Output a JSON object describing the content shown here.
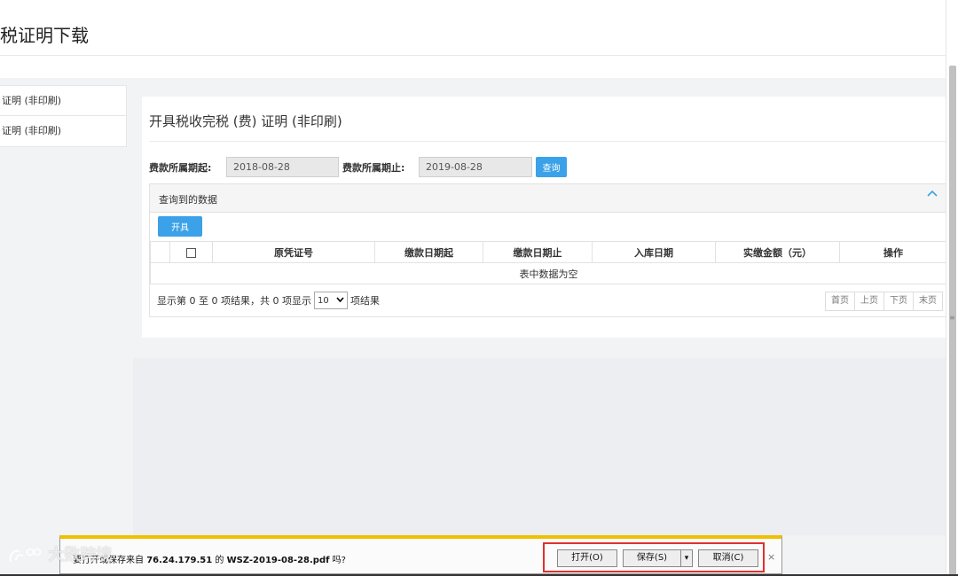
{
  "header": {
    "title": "税证明下载"
  },
  "sidebar": {
    "items": [
      {
        "label": "证明 (非印刷)"
      },
      {
        "label": "证明 (非印刷)"
      }
    ]
  },
  "panel": {
    "title": "开具税收完税 (费) 证明 (非印刷)",
    "filters": {
      "start_label": "费款所属期起:",
      "start_value": "2018-08-28",
      "end_label": "费款所属期止:",
      "end_value": "2019-08-28",
      "query_button": "查询"
    },
    "results": {
      "title": "查询到的数据",
      "issue_button": "开具",
      "columns": [
        "原凭证号",
        "缴款日期起",
        "缴款日期止",
        "入库日期",
        "实缴金额（元）",
        "操作"
      ],
      "empty_text": "表中数据为空",
      "pager_text_before": "显示第 0 至 0 项结果，共 0 项显示",
      "page_size": "10",
      "pager_text_after": "项结果",
      "pager_buttons": {
        "first": "首页",
        "prev": "上页",
        "next": "下页",
        "last": "末页"
      }
    }
  },
  "download_bar": {
    "message_prefix": "要打开或保存来自 ",
    "host": "76.24.179.51",
    "message_mid": " 的 ",
    "filename": "WSZ-2019-08-28.pdf",
    "message_suffix": " 吗?",
    "open_button": "打开(O)",
    "save_button": "保存(S)",
    "save_arrow": "▾",
    "cancel_button": "取消(C)",
    "close": "×"
  },
  "watermark": "大数跨境",
  "icons": {
    "collapse": "chevron-up-icon",
    "dropdown": "chevron-down-icon",
    "close": "close-icon"
  },
  "colors": {
    "accent": "#3ba1e8",
    "highlight_border": "#e03030",
    "download_bar_top": "#f0c000"
  }
}
